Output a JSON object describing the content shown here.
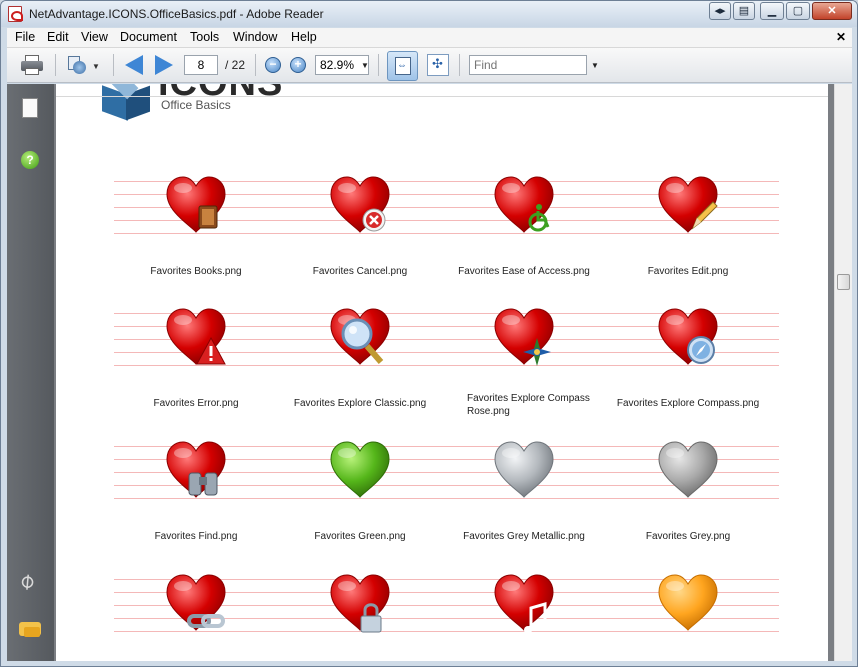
{
  "window": {
    "title": "NetAdvantage.ICONS.OfficeBasics.pdf - Adobe Reader"
  },
  "menu": {
    "file": "File",
    "edit": "Edit",
    "view": "View",
    "document": "Document",
    "tools": "Tools",
    "window": "Window",
    "help": "Help",
    "close_glyph": "✕"
  },
  "toolbar": {
    "page_current": "8",
    "page_total": "/ 22",
    "zoom": "82.9%",
    "find_placeholder": "Find"
  },
  "page": {
    "logo_title": "ICONS",
    "logo_subtitle": "Office Basics"
  },
  "icons": [
    {
      "caption": "Favorites Books.png",
      "color": "red",
      "overlay": "book-icon"
    },
    {
      "caption": "Favorites Cancel.png",
      "color": "red",
      "overlay": "cancel-icon"
    },
    {
      "caption": "Favorites Ease of Access.png",
      "color": "red",
      "overlay": "wheelchair-icon"
    },
    {
      "caption": "Favorites Edit.png",
      "color": "red",
      "overlay": "pencil-icon"
    },
    {
      "caption": "Favorites Error.png",
      "color": "red",
      "overlay": "warning-icon"
    },
    {
      "caption": "Favorites Explore Classic.png",
      "color": "red",
      "overlay": "magnifier-icon"
    },
    {
      "caption": "Favorites Explore Compass Rose.png",
      "color": "red",
      "overlay": "compass-rose-icon"
    },
    {
      "caption": "Favorites Explore Compass.png",
      "color": "red",
      "overlay": "compass-icon"
    },
    {
      "caption": "Favorites Find.png",
      "color": "red",
      "overlay": "binoculars-icon"
    },
    {
      "caption": "Favorites Green.png",
      "color": "green",
      "overlay": ""
    },
    {
      "caption": "Favorites Grey Metallic.png",
      "color": "grey-metallic",
      "overlay": ""
    },
    {
      "caption": "Favorites Grey.png",
      "color": "grey",
      "overlay": ""
    },
    {
      "caption": "",
      "color": "red",
      "overlay": "link-icon"
    },
    {
      "caption": "",
      "color": "red",
      "overlay": "lock-icon"
    },
    {
      "caption": "",
      "color": "red",
      "overlay": "music-icon"
    },
    {
      "caption": "",
      "color": "orange",
      "overlay": ""
    }
  ],
  "colors": {
    "red": [
      "#ff7a7a",
      "#d40000",
      "#8a0000"
    ],
    "green": [
      "#b8f27a",
      "#55b61a",
      "#2f6d08"
    ],
    "grey-metallic": [
      "#f2f4f6",
      "#b3b8bd",
      "#6f757b"
    ],
    "grey": [
      "#e6e6e6",
      "#a9a9a9",
      "#6a6a6a"
    ],
    "orange": [
      "#ffd889",
      "#ffa51f",
      "#c56e00"
    ]
  }
}
